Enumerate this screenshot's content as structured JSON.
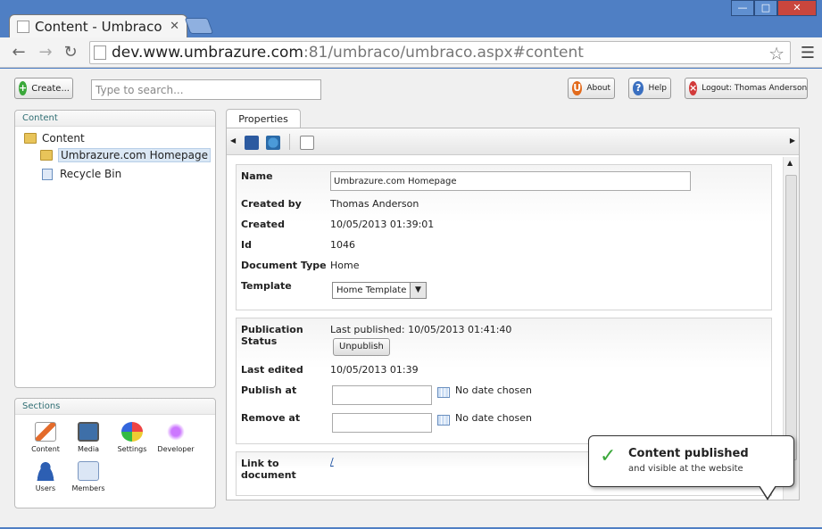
{
  "browser": {
    "tab_title": "Content - Umbraco C",
    "url_host": "dev.www.umbrazure.com",
    "url_rest": ":81/umbraco/umbraco.aspx#content"
  },
  "toolbar": {
    "create_label": "Create...",
    "search_placeholder": "Type to search...",
    "about_label": "About",
    "help_label": "Help",
    "logout_label": "Logout: Thomas Anderson"
  },
  "tree": {
    "header": "Content",
    "root": "Content",
    "items": [
      {
        "label": "Umbrazure.com Homepage"
      },
      {
        "label": "Recycle Bin"
      }
    ]
  },
  "sections": {
    "header": "Sections",
    "items": [
      {
        "label": "Content"
      },
      {
        "label": "Media"
      },
      {
        "label": "Settings"
      },
      {
        "label": "Developer"
      },
      {
        "label": "Users"
      },
      {
        "label": "Members"
      }
    ]
  },
  "editor": {
    "tab": "Properties",
    "name_label": "Name",
    "name_value": "Umbrazure.com Homepage",
    "created_by_label": "Created by",
    "created_by_value": "Thomas Anderson",
    "created_label": "Created",
    "created_value": "10/05/2013 01:39:01",
    "id_label": "Id",
    "id_value": "1046",
    "doctype_label": "Document Type",
    "doctype_value": "Home",
    "template_label": "Template",
    "template_value": "Home Template",
    "pub_status_label": "Publication Status",
    "last_published": "Last published: 10/05/2013 01:41:40",
    "unpublish_label": "Unpublish",
    "last_edited_label": "Last edited",
    "last_edited_value": "10/05/2013 01:39",
    "publish_at_label": "Publish at",
    "remove_at_label": "Remove at",
    "no_date": "No date chosen",
    "link_label": "Link to document",
    "link_value": "/"
  },
  "toast": {
    "title": "Content published",
    "message": "and visible at the website"
  }
}
